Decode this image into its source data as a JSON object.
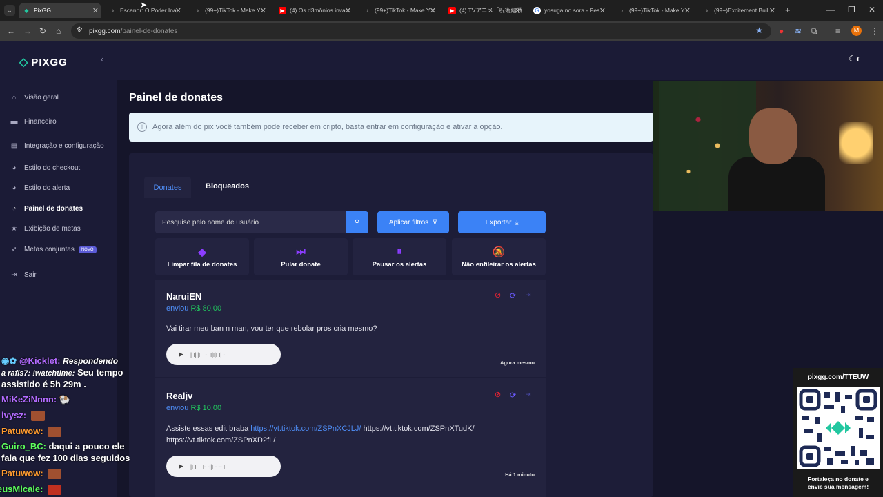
{
  "browser": {
    "tabs": [
      {
        "title": "PixGG"
      },
      {
        "title": "Escanor: O Poder Ina"
      },
      {
        "title": "(99+)TikTok - Make Y"
      },
      {
        "title": "(4) Os d3mônios inva"
      },
      {
        "title": "(99+)TikTok - Make Y"
      },
      {
        "title": "(4) TVアニメ「呪術廻戦"
      },
      {
        "title": "yosuga no sora - Pes"
      },
      {
        "title": "(99+)TikTok - Make Y"
      },
      {
        "title": "(99+)Excitement Buil"
      }
    ],
    "url_domain": "pixgg.com",
    "url_path": "/painel-de-donates",
    "profile_initial": "M"
  },
  "sidebar": {
    "logo": "PIXGG",
    "items": [
      {
        "label": "Visão geral"
      },
      {
        "label": "Financeiro"
      },
      {
        "label": "Integração e configuração"
      },
      {
        "label": "Estilo do checkout"
      },
      {
        "label": "Estilo do alerta"
      },
      {
        "label": "Painel de donates"
      },
      {
        "label": "Exibição de metas"
      },
      {
        "label": "Metas conjuntas",
        "badge": "NOVO"
      },
      {
        "label": "Sair"
      }
    ]
  },
  "main": {
    "title": "Painel de donates",
    "info": "Agora além do pix você também pode receber em cripto, basta entrar em configuração e ativar a opção.",
    "tabs": [
      "Donates",
      "Bloqueados"
    ],
    "search_placeholder": "Pesquise pelo nome de usuário",
    "filter_label": "Aplicar filtros",
    "export_label": "Exportar",
    "actions": [
      "Limpar fila de donates",
      "Pular donate",
      "Pausar os alertas",
      "Não enfileirar os alertas"
    ],
    "donations": [
      {
        "name": "NaruiEN",
        "sent_label": "enviou",
        "amount": "R$ 80,00",
        "message": "Vai tirar meu ban n man, vou ter que rebolar pros cria mesmo?",
        "time": "Agora mesmo"
      },
      {
        "name": "Realjv",
        "sent_label": "enviou",
        "amount": "R$ 10,00",
        "message_pre": "Assiste essas edit braba ",
        "message_link": "https://vt.tiktok.com/ZSPnXCJLJ/",
        "message_post": " https://vt.tiktok.com/ZSPnXTudK/",
        "message_line2": "https://vt.tiktok.com/ZSPnXD2fL/",
        "time": "Há 1 minuto"
      }
    ]
  },
  "overlay": {
    "qr_url": "pixgg.com/TTEUW",
    "qr_caption_1": "Fortaleça no donate e",
    "qr_caption_2": "envie sua mensagem!"
  },
  "chat": [
    {
      "user": "@Kicklet:",
      "text_italic": "Respondendo",
      "color": "#b36bff"
    },
    {
      "text_italic": "a rafis7: !watchtime:",
      "text": "Seu tempo"
    },
    {
      "text": "assistido é 5h 29m ."
    },
    {
      "user": "MiKeZiNnnn:",
      "color": "#b36bff"
    },
    {
      "user": "ivysz:",
      "color": "#b36bff"
    },
    {
      "user": "Patuwow:",
      "color": "#ff9b2f"
    },
    {
      "user": "Guiro_BC:",
      "text": "daqui a pouco ele",
      "color": "#5dff5d"
    },
    {
      "text": "fala que fez 100 dias seguidos"
    },
    {
      "user": "Patuwow:",
      "color": "#ff9b2f"
    },
    {
      "user": "eusMicale:",
      "color": "#5dff5d"
    }
  ]
}
